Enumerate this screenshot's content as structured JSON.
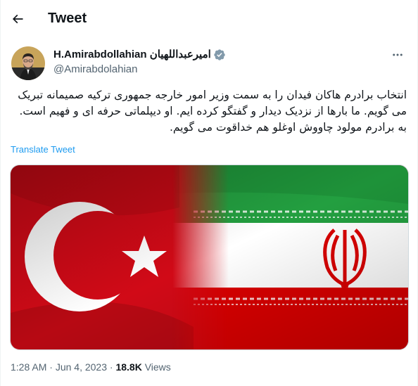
{
  "header": {
    "title": "Tweet"
  },
  "author": {
    "display_name": "H.Amirabdollahian امیرعبداللهیان",
    "handle": "@Amirabdolahian",
    "verified": true
  },
  "tweet": {
    "text": "انتخاب برادرم هاکان فیدان را به سمت وزیر امور خارجه جمهوری ترکیه صمیمانه تبریک می گویم. ما بارها از نزدیک دیدار و گفتگو کرده ایم. او دیپلماتی حرفه ای و فهیم است. به برادرم مولود چاووش اوغلو هم خداقوت می گویم.",
    "translate_label": "Translate Tweet"
  },
  "meta": {
    "time": "1:28 AM",
    "date": "Jun 4, 2023",
    "views_count": "18.8K",
    "views_label": "Views"
  },
  "colors": {
    "accent": "#1d9bf0",
    "secondary_text": "#536471",
    "turkey_red": "#e30a17",
    "iran_green": "#239f40",
    "iran_red": "#da0000"
  }
}
